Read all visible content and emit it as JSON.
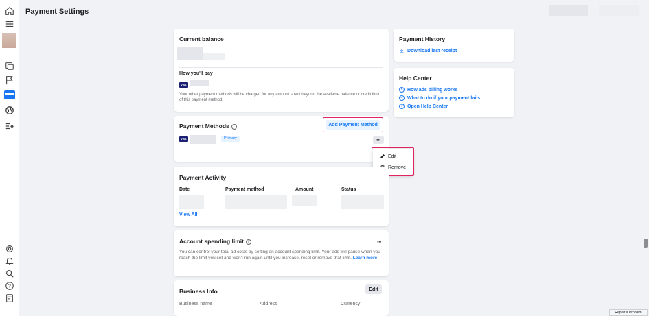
{
  "page": {
    "title": "Payment Settings",
    "report_problem": "Report a Problem"
  },
  "rail": {
    "icons": [
      "home-icon",
      "menu-icon",
      "avatar",
      "chart-icon",
      "flag-icon",
      "billing-icon",
      "globe-icon",
      "list-settings-icon",
      "settings-icon",
      "bell-icon",
      "search-icon",
      "help-icon",
      "report-icon"
    ]
  },
  "balance_card": {
    "title": "Current balance",
    "how_pay_title": "How you'll pay",
    "card_brand": "VISA",
    "note": "Your other payment methods will be charged for any amount spent beyond the available balance or credit limit of this payment method."
  },
  "payment_methods": {
    "title": "Payment Methods",
    "info_icon": "i",
    "add_button": "Add Payment Method",
    "card_brand": "VISA",
    "badge": "Primary",
    "more": "···"
  },
  "context_menu": {
    "items": [
      "Edit",
      "Remove"
    ]
  },
  "payment_activity": {
    "title": "Payment Activity",
    "columns": [
      "Date",
      "Payment method",
      "Amount",
      "Status"
    ],
    "view_all": "View All"
  },
  "spending_limit": {
    "title": "Account spending limit",
    "info_icon": "i",
    "more": "···",
    "text": "You can control your total ad costs by setting an account spending limit. Your ads will pause when you reach the limit you set and won't run again until you increase, reset or remove that limit.",
    "learn_more": "Learn more"
  },
  "business_info": {
    "title": "Business Info",
    "edit_button": "Edit",
    "columns": [
      "Business name",
      "Address",
      "Currency"
    ]
  },
  "payment_history": {
    "title": "Payment History",
    "download": "Download last receipt"
  },
  "help_center": {
    "title": "Help Center",
    "links": [
      "How ads billing works",
      "What to do if your payment fails",
      "Open Help Center"
    ]
  },
  "colors": {
    "accent": "#1877f2",
    "highlight_border": "#e0245e",
    "background": "#f0f2f5"
  }
}
